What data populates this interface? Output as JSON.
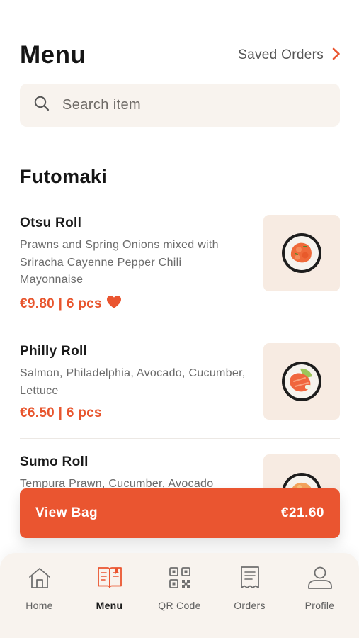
{
  "header": {
    "title": "Menu",
    "saved_orders_label": "Saved Orders"
  },
  "search": {
    "placeholder": "Search item",
    "value": ""
  },
  "section": {
    "title": "Futomaki"
  },
  "items": [
    {
      "name": "Otsu Roll",
      "description": "Prawns and Spring Onions mixed with Sriracha Cayenne Pepper Chili Mayonnaise",
      "price": "€9.80 | 6 pcs",
      "favorite": true
    },
    {
      "name": "Philly Roll",
      "description": "Salmon, Philadelphia, Avocado, Cucumber, Lettuce",
      "price": "€6.50 | 6 pcs",
      "favorite": false
    },
    {
      "name": "Sumo Roll",
      "description": "Tempura Prawn, Cucumber, Avocado",
      "price": "",
      "favorite": false
    }
  ],
  "bag": {
    "label": "View Bag",
    "total": "€21.60"
  },
  "tabs": [
    {
      "label": "Home",
      "icon": "home-icon",
      "active": false
    },
    {
      "label": "Menu",
      "icon": "menu-book-icon",
      "active": true
    },
    {
      "label": "QR Code",
      "icon": "qr-code-icon",
      "active": false
    },
    {
      "label": "Orders",
      "icon": "receipt-icon",
      "active": false
    },
    {
      "label": "Profile",
      "icon": "user-icon",
      "active": false
    }
  ],
  "colors": {
    "accent": "#ea5530",
    "surface": "#f8f3ee",
    "thumb_bg": "#f7ebe2",
    "text": "#1a1a1a",
    "muted": "#6b6b6b"
  }
}
